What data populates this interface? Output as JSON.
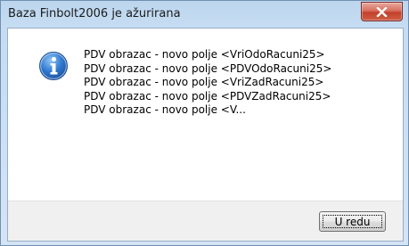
{
  "window": {
    "title": "Baza Finbolt2006 je ažurirana",
    "close_icon": "close-icon"
  },
  "dialog": {
    "icon": "info-icon",
    "messages": [
      "PDV obrazac - novo polje <VriOdoRacuni25>",
      "PDV obrazac - novo polje <PDVOdoRacuni25>",
      "PDV obrazac - novo polje <VriZadRacuni25>",
      "PDV obrazac - novo polje <PDVZadRacuni25>",
      "PDV obrazac - novo polje <V..."
    ],
    "ok_label": "U redu"
  },
  "colors": {
    "close_button": "#c2402c",
    "info_icon": "#2a6ec6"
  }
}
